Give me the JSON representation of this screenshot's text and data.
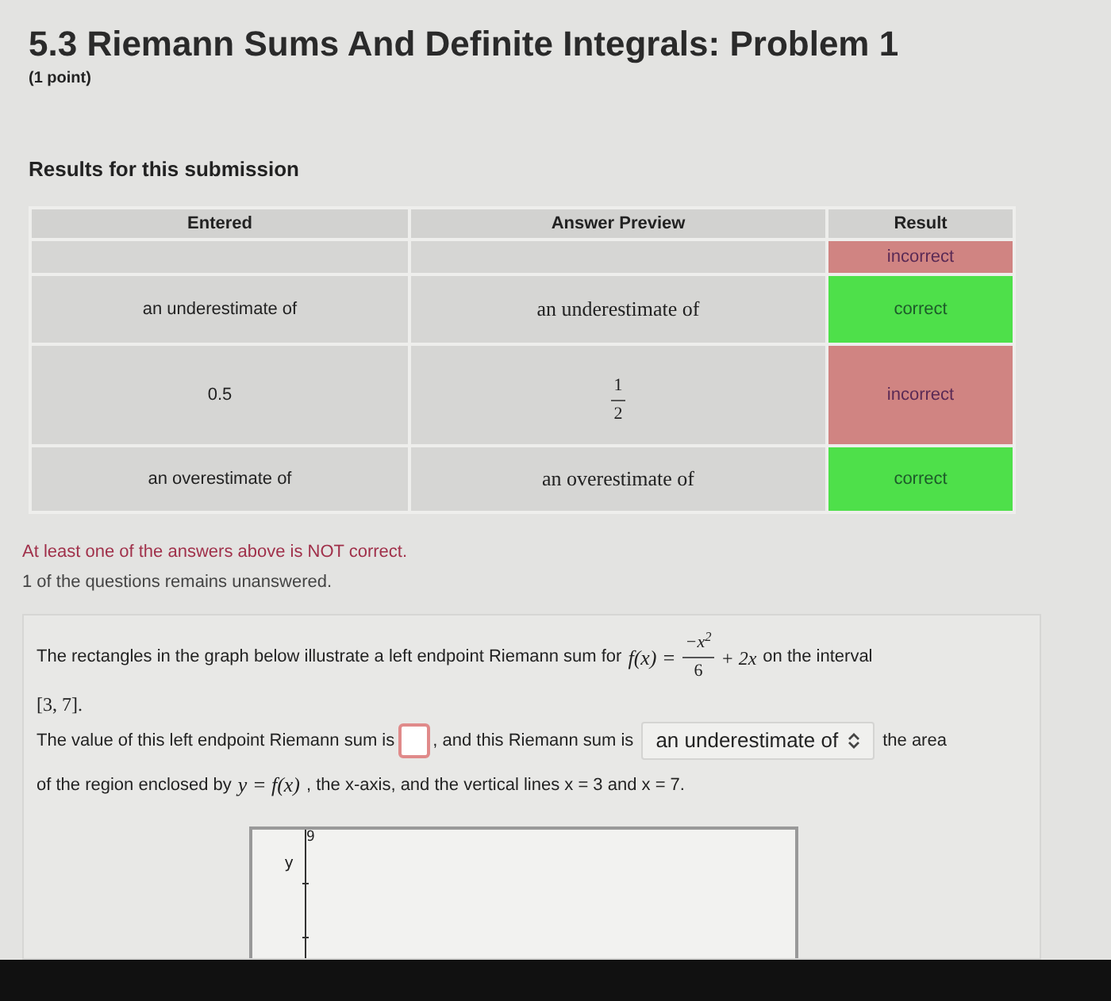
{
  "title": "5.3 Riemann Sums And Definite Integrals: Problem 1",
  "points": "(1 point)",
  "results_heading": "Results for this submission",
  "table": {
    "columns": [
      "Entered",
      "Answer Preview",
      "Result"
    ],
    "rows": [
      {
        "kind": "blank",
        "result": "incorrect",
        "correct": false
      },
      {
        "entered": "an underestimate of",
        "preview": "an underestimate of",
        "kind": "text",
        "result": "correct",
        "correct": true
      },
      {
        "entered": "0.5",
        "kind": "fraction",
        "numerator": "1",
        "denominator": "2",
        "result": "incorrect",
        "correct": false
      },
      {
        "entered": "an overestimate of",
        "preview": "an overestimate of",
        "kind": "text",
        "result": "correct",
        "correct": true
      }
    ]
  },
  "messages": [
    {
      "text": "At least one of the answers above is NOT correct.",
      "kind": "error"
    },
    {
      "text": "1 of the questions remains unanswered.",
      "kind": "info"
    }
  ],
  "problem": {
    "intro": "The rectangles in the graph below illustrate a left endpoint Riemann sum for",
    "lhs": "f(x) =",
    "numerator": "−x$^{2}$",
    "denominator": "6",
    "rhs": "+ 2x",
    "after": "on the interval",
    "interval": "[3, 7].",
    "sentence_start": "The value of this left endpoint Riemann sum is",
    "answer_flagged": true,
    "sentence_mid": ", and this Riemann sum is",
    "select_value": "an underestimate of",
    "sentence_end": "the area",
    "line2_start": "of the region enclosed by",
    "line2_math": "y = f(x)",
    "line2_end": ", the x-axis, and the vertical lines x = 3 and x = 7."
  },
  "graph": {
    "ylabel": "y",
    "ymax": "9"
  }
}
